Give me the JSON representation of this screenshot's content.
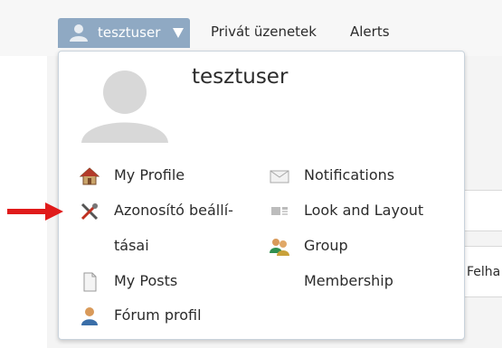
{
  "nav": {
    "username": "tesztuser",
    "links": [
      "Privát üzenetek",
      "Alerts"
    ]
  },
  "dropdown": {
    "username": "tesztuser",
    "left_items": {
      "my_profile": "My Profile",
      "account_settings_line1": "Azonosító beállí-",
      "account_settings_line2": "tásai",
      "my_posts": "My Posts",
      "forum_profile": "Fórum profil"
    },
    "right_items": {
      "notifications": "Notifications",
      "look_and_layout": "Look and Layout",
      "group_line1": "Group",
      "group_line2": "Membership"
    }
  },
  "background": {
    "partial_text": "Felha"
  },
  "colors": {
    "nav_button": "#8fa9c3",
    "annotation_arrow": "#e01b1b"
  },
  "icons": [
    "user-icon",
    "caret-down-icon",
    "home-icon",
    "tools-icon",
    "document-icon",
    "person-icon",
    "envelope-icon",
    "layout-icon",
    "group-icon",
    "red-arrow"
  ]
}
